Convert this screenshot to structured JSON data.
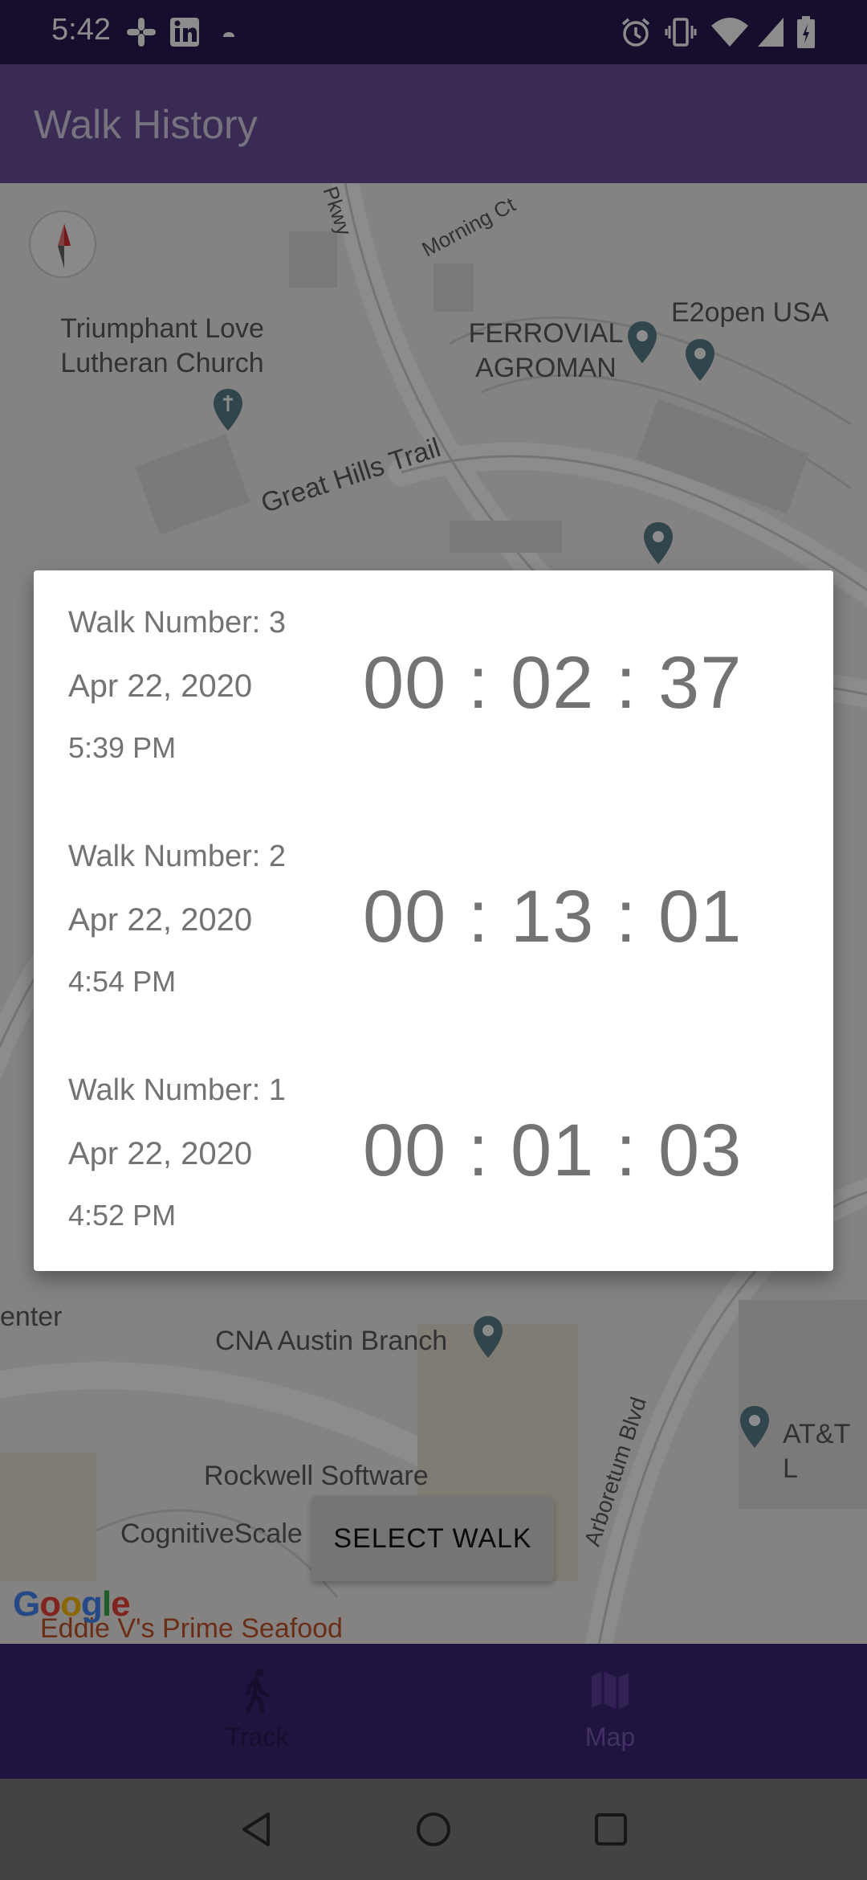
{
  "status_bar": {
    "time": "5:42",
    "left_icons": [
      "slack-icon",
      "linkedin-icon",
      "cloud-icon"
    ],
    "right_icons": [
      "alarm-icon",
      "vibrate-icon",
      "wifi-icon",
      "signal-icon",
      "battery-icon"
    ]
  },
  "app_bar": {
    "title": "Walk History"
  },
  "map": {
    "labels": {
      "church": "Triumphant Love Lutheran Church",
      "ferrovial": "FERROVIAL AGROMAN",
      "e2open": "E2open USA",
      "great_hills": "Great Hills Trail",
      "morning": "Morning Ct",
      "pkwy": "Pkwy",
      "center": "enter",
      "cna": "CNA Austin Branch",
      "arboretum": "Arboretum Blvd",
      "att": "AT&T L",
      "rockwell": "Rockwell Software",
      "cognitive": "CognitiveScale",
      "eddie": "Eddie V's Prime Seafood",
      "google": "Google"
    },
    "select_walk_label": "SELECT WALK"
  },
  "dialog": {
    "walks": [
      {
        "number_label": "Walk Number: 3",
        "date": "Apr 22, 2020",
        "time": "5:39 PM",
        "duration": "00 : 02 : 37"
      },
      {
        "number_label": "Walk Number: 2",
        "date": "Apr 22, 2020",
        "time": "4:54 PM",
        "duration": "00 : 13 : 01"
      },
      {
        "number_label": "Walk Number: 1",
        "date": "Apr 22, 2020",
        "time": "4:52 PM",
        "duration": "00 : 01 : 03"
      }
    ]
  },
  "bottom_nav": {
    "items": [
      {
        "label": "Track",
        "icon": "walk-icon"
      },
      {
        "label": "Map",
        "icon": "map-icon"
      }
    ]
  },
  "system_nav": {
    "buttons": [
      "back-icon",
      "home-icon",
      "recents-icon"
    ]
  },
  "colors": {
    "status_bar": "#2a1950",
    "app_bar": "#6a4f9c",
    "bottom_nav": "#3a2373",
    "nav_label": "#7a5ab8",
    "pin": "#5a7f8d"
  }
}
